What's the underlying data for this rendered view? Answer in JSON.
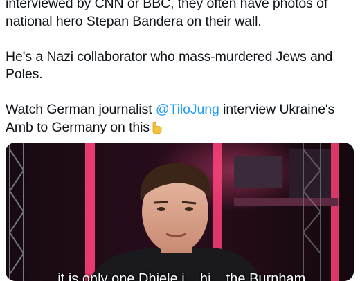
{
  "tweet": {
    "paragraphs": {
      "p1_line1": "interviewed by CNN or BBC, they often have photos of",
      "p1_line2": "national hero Stepan Bandera on their wall.",
      "p2_line1": "He's a Nazi collaborator who mass-murdered Jews and",
      "p2_line2": "Poles.",
      "p3_prefix": "Watch German journalist ",
      "p3_mention": "@TiloJung",
      "p3_suffix": " interview Ukraine's",
      "p3_line2": "Amb to Germany on this"
    },
    "emoji": "backhand-index-pointing-down-icon"
  },
  "video": {
    "subtitle": "... it is only one Dhiele i... hi... the Burnham... "
  },
  "colors": {
    "mention": "#1d9bf0",
    "text": "#0f1419"
  }
}
